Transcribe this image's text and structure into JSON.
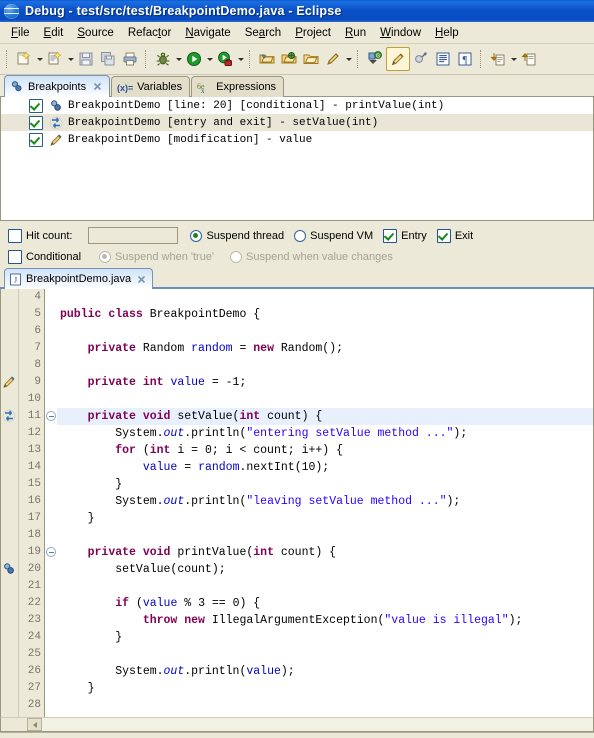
{
  "window": {
    "title": "Debug - test/src/test/BreakpointDemo.java - Eclipse",
    "logo_icon": "eclipse-logo-icon"
  },
  "menubar": {
    "items": [
      {
        "label": "File",
        "mnemonic": "F"
      },
      {
        "label": "Edit",
        "mnemonic": "E"
      },
      {
        "label": "Source",
        "mnemonic": "S"
      },
      {
        "label": "Refactor",
        "mnemonic": "t"
      },
      {
        "label": "Navigate",
        "mnemonic": "N"
      },
      {
        "label": "Search",
        "mnemonic": "a"
      },
      {
        "label": "Project",
        "mnemonic": "P"
      },
      {
        "label": "Run",
        "mnemonic": "R"
      },
      {
        "label": "Window",
        "mnemonic": "W"
      },
      {
        "label": "Help",
        "mnemonic": "H"
      }
    ]
  },
  "toolbar": {
    "groups": [
      {
        "buttons": [
          {
            "icon": "new-java-project-icon",
            "dropdown": true
          },
          {
            "icon": "new-java-class-icon",
            "dropdown": true
          },
          {
            "icon": "save-icon",
            "dropdown": false
          },
          {
            "icon": "save-all-icon",
            "dropdown": false
          },
          {
            "icon": "print-icon",
            "dropdown": false
          }
        ]
      },
      {
        "buttons": [
          {
            "icon": "debug-icon",
            "dropdown": true
          },
          {
            "icon": "run-icon",
            "dropdown": true
          },
          {
            "icon": "run-external-tools-icon",
            "dropdown": true
          }
        ]
      },
      {
        "buttons": [
          {
            "icon": "open-type-icon",
            "dropdown": false
          },
          {
            "icon": "open-task-icon",
            "dropdown": false
          },
          {
            "icon": "open-resource-icon",
            "dropdown": false
          },
          {
            "icon": "search-pencil-icon",
            "dropdown": true
          }
        ]
      },
      {
        "buttons": [
          {
            "icon": "next-annotation-icon",
            "dropdown": false
          },
          {
            "icon": "highlight-pencil-icon",
            "dropdown": false,
            "pressed": true
          },
          {
            "icon": "toggle-mark-occurrences-icon",
            "dropdown": false
          },
          {
            "icon": "show-whitespace-block-icon",
            "dropdown": false
          },
          {
            "icon": "show-pilcrow-icon",
            "dropdown": false
          }
        ]
      },
      {
        "buttons": [
          {
            "icon": "step-into-download-icon",
            "dropdown": true
          },
          {
            "icon": "step-return-icon",
            "dropdown": false
          }
        ]
      }
    ]
  },
  "breakpoints_view": {
    "tabs": [
      {
        "label": "Breakpoints",
        "icon": "breakpoints-view-icon",
        "active": true,
        "closable": true
      },
      {
        "label": "Variables",
        "icon": "variables-view-icon",
        "active": false,
        "closable": false
      },
      {
        "label": "Expressions",
        "icon": "expressions-view-icon",
        "active": false,
        "closable": false
      }
    ],
    "rows": [
      {
        "checked": true,
        "icon": "line-breakpoint-icon",
        "label": "BreakpointDemo [line: 20] [conditional] - printValue(int)",
        "selected": false
      },
      {
        "checked": true,
        "icon": "method-breakpoint-icon",
        "label": "BreakpointDemo [entry and exit] - setValue(int)",
        "selected": true
      },
      {
        "checked": true,
        "icon": "watchpoint-icon",
        "label": "BreakpointDemo [modification] - value",
        "selected": false
      }
    ],
    "detail": {
      "hit_count_label": "Hit count:",
      "hit_count_checked": false,
      "hit_count_value": "",
      "suspend_thread_label": "Suspend thread",
      "suspend_thread_selected": true,
      "suspend_vm_label": "Suspend VM",
      "suspend_vm_selected": false,
      "entry_label": "Entry",
      "entry_checked": true,
      "exit_label": "Exit",
      "exit_checked": true,
      "conditional_label": "Conditional",
      "conditional_checked": false,
      "suspend_when_true_label": "Suspend when 'true'",
      "suspend_when_true_selected": true,
      "suspend_when_true_enabled": false,
      "suspend_when_change_label": "Suspend when value changes",
      "suspend_when_change_selected": false,
      "suspend_when_change_enabled": false
    }
  },
  "editor": {
    "tab": {
      "label": "BreakpointDemo.java",
      "icon": "java-file-icon",
      "closable": true
    },
    "first_line": 4,
    "lines": [
      {
        "num": 4,
        "marker": null,
        "fold": null,
        "current": false,
        "tokens": []
      },
      {
        "num": 5,
        "marker": null,
        "fold": null,
        "current": false,
        "tokens": [
          {
            "t": "public ",
            "c": "kw"
          },
          {
            "t": "class ",
            "c": "kw"
          },
          {
            "t": "BreakpointDemo {",
            "c": "plain"
          }
        ]
      },
      {
        "num": 6,
        "marker": null,
        "fold": null,
        "current": false,
        "tokens": []
      },
      {
        "num": 7,
        "marker": null,
        "fold": null,
        "current": false,
        "tokens": [
          {
            "t": "    ",
            "c": "plain"
          },
          {
            "t": "private ",
            "c": "kw"
          },
          {
            "t": "Random ",
            "c": "plain"
          },
          {
            "t": "random",
            "c": "fld"
          },
          {
            "t": " = ",
            "c": "plain"
          },
          {
            "t": "new ",
            "c": "kw"
          },
          {
            "t": "Random();",
            "c": "plain"
          }
        ]
      },
      {
        "num": 8,
        "marker": null,
        "fold": null,
        "current": false,
        "tokens": []
      },
      {
        "num": 9,
        "marker": "watchpoint-icon",
        "fold": null,
        "current": false,
        "tokens": [
          {
            "t": "    ",
            "c": "plain"
          },
          {
            "t": "private ",
            "c": "kw"
          },
          {
            "t": "int ",
            "c": "kw"
          },
          {
            "t": "value",
            "c": "fld"
          },
          {
            "t": " = -1;",
            "c": "plain"
          }
        ]
      },
      {
        "num": 10,
        "marker": null,
        "fold": null,
        "current": false,
        "tokens": []
      },
      {
        "num": 11,
        "marker": "method-breakpoint-icon",
        "fold": "collapse",
        "current": true,
        "tokens": [
          {
            "t": "    ",
            "c": "plain"
          },
          {
            "t": "private ",
            "c": "kw"
          },
          {
            "t": "void ",
            "c": "kw"
          },
          {
            "t": "setValue(",
            "c": "plain"
          },
          {
            "t": "int ",
            "c": "kw"
          },
          {
            "t": "count) {",
            "c": "plain"
          }
        ]
      },
      {
        "num": 12,
        "marker": null,
        "fold": null,
        "current": false,
        "tokens": [
          {
            "t": "        System.",
            "c": "plain"
          },
          {
            "t": "out",
            "c": "stat"
          },
          {
            "t": ".println(",
            "c": "plain"
          },
          {
            "t": "\"entering setValue method ...\"",
            "c": "str"
          },
          {
            "t": ");",
            "c": "plain"
          }
        ]
      },
      {
        "num": 13,
        "marker": null,
        "fold": null,
        "current": false,
        "tokens": [
          {
            "t": "        ",
            "c": "plain"
          },
          {
            "t": "for ",
            "c": "kw"
          },
          {
            "t": "(",
            "c": "plain"
          },
          {
            "t": "int ",
            "c": "kw"
          },
          {
            "t": "i = 0; i < count; i++) {",
            "c": "plain"
          }
        ]
      },
      {
        "num": 14,
        "marker": null,
        "fold": null,
        "current": false,
        "tokens": [
          {
            "t": "            ",
            "c": "plain"
          },
          {
            "t": "value",
            "c": "fld"
          },
          {
            "t": " = ",
            "c": "plain"
          },
          {
            "t": "random",
            "c": "fld"
          },
          {
            "t": ".nextInt(10);",
            "c": "plain"
          }
        ]
      },
      {
        "num": 15,
        "marker": null,
        "fold": null,
        "current": false,
        "tokens": [
          {
            "t": "        }",
            "c": "plain"
          }
        ]
      },
      {
        "num": 16,
        "marker": null,
        "fold": null,
        "current": false,
        "tokens": [
          {
            "t": "        System.",
            "c": "plain"
          },
          {
            "t": "out",
            "c": "stat"
          },
          {
            "t": ".println(",
            "c": "plain"
          },
          {
            "t": "\"leaving setValue method ...\"",
            "c": "str"
          },
          {
            "t": ");",
            "c": "plain"
          }
        ]
      },
      {
        "num": 17,
        "marker": null,
        "fold": null,
        "current": false,
        "tokens": [
          {
            "t": "    }",
            "c": "plain"
          }
        ]
      },
      {
        "num": 18,
        "marker": null,
        "fold": null,
        "current": false,
        "tokens": []
      },
      {
        "num": 19,
        "marker": null,
        "fold": "collapse",
        "current": false,
        "tokens": [
          {
            "t": "    ",
            "c": "plain"
          },
          {
            "t": "private ",
            "c": "kw"
          },
          {
            "t": "void ",
            "c": "kw"
          },
          {
            "t": "printValue(",
            "c": "plain"
          },
          {
            "t": "int ",
            "c": "kw"
          },
          {
            "t": "count) {",
            "c": "plain"
          }
        ]
      },
      {
        "num": 20,
        "marker": "line-breakpoint-icon",
        "fold": null,
        "current": false,
        "tokens": [
          {
            "t": "        setValue(count);",
            "c": "plain"
          }
        ]
      },
      {
        "num": 21,
        "marker": null,
        "fold": null,
        "current": false,
        "tokens": []
      },
      {
        "num": 22,
        "marker": null,
        "fold": null,
        "current": false,
        "tokens": [
          {
            "t": "        ",
            "c": "plain"
          },
          {
            "t": "if ",
            "c": "kw"
          },
          {
            "t": "(",
            "c": "plain"
          },
          {
            "t": "value",
            "c": "fld"
          },
          {
            "t": " % 3 == 0) {",
            "c": "plain"
          }
        ]
      },
      {
        "num": 23,
        "marker": null,
        "fold": null,
        "current": false,
        "tokens": [
          {
            "t": "            ",
            "c": "plain"
          },
          {
            "t": "throw ",
            "c": "kw"
          },
          {
            "t": "new ",
            "c": "kw"
          },
          {
            "t": "IllegalArgumentException(",
            "c": "plain"
          },
          {
            "t": "\"value is illegal\"",
            "c": "str"
          },
          {
            "t": ");",
            "c": "plain"
          }
        ]
      },
      {
        "num": 24,
        "marker": null,
        "fold": null,
        "current": false,
        "tokens": [
          {
            "t": "        }",
            "c": "plain"
          }
        ]
      },
      {
        "num": 25,
        "marker": null,
        "fold": null,
        "current": false,
        "tokens": []
      },
      {
        "num": 26,
        "marker": null,
        "fold": null,
        "current": false,
        "tokens": [
          {
            "t": "        System.",
            "c": "plain"
          },
          {
            "t": "out",
            "c": "stat"
          },
          {
            "t": ".println(",
            "c": "plain"
          },
          {
            "t": "value",
            "c": "fld"
          },
          {
            "t": ");",
            "c": "plain"
          }
        ]
      },
      {
        "num": 27,
        "marker": null,
        "fold": null,
        "current": false,
        "tokens": [
          {
            "t": "    }",
            "c": "plain"
          }
        ]
      },
      {
        "num": 28,
        "marker": null,
        "fold": null,
        "current": false,
        "tokens": []
      }
    ]
  },
  "colors": {
    "title_bar": "#0a4cc0",
    "chrome": "#ece9d8",
    "keyword": "#7f0055",
    "string": "#2a00ff",
    "field": "#0000c0",
    "current_line": "#e8f0fe",
    "selection": "#eae6d7"
  }
}
